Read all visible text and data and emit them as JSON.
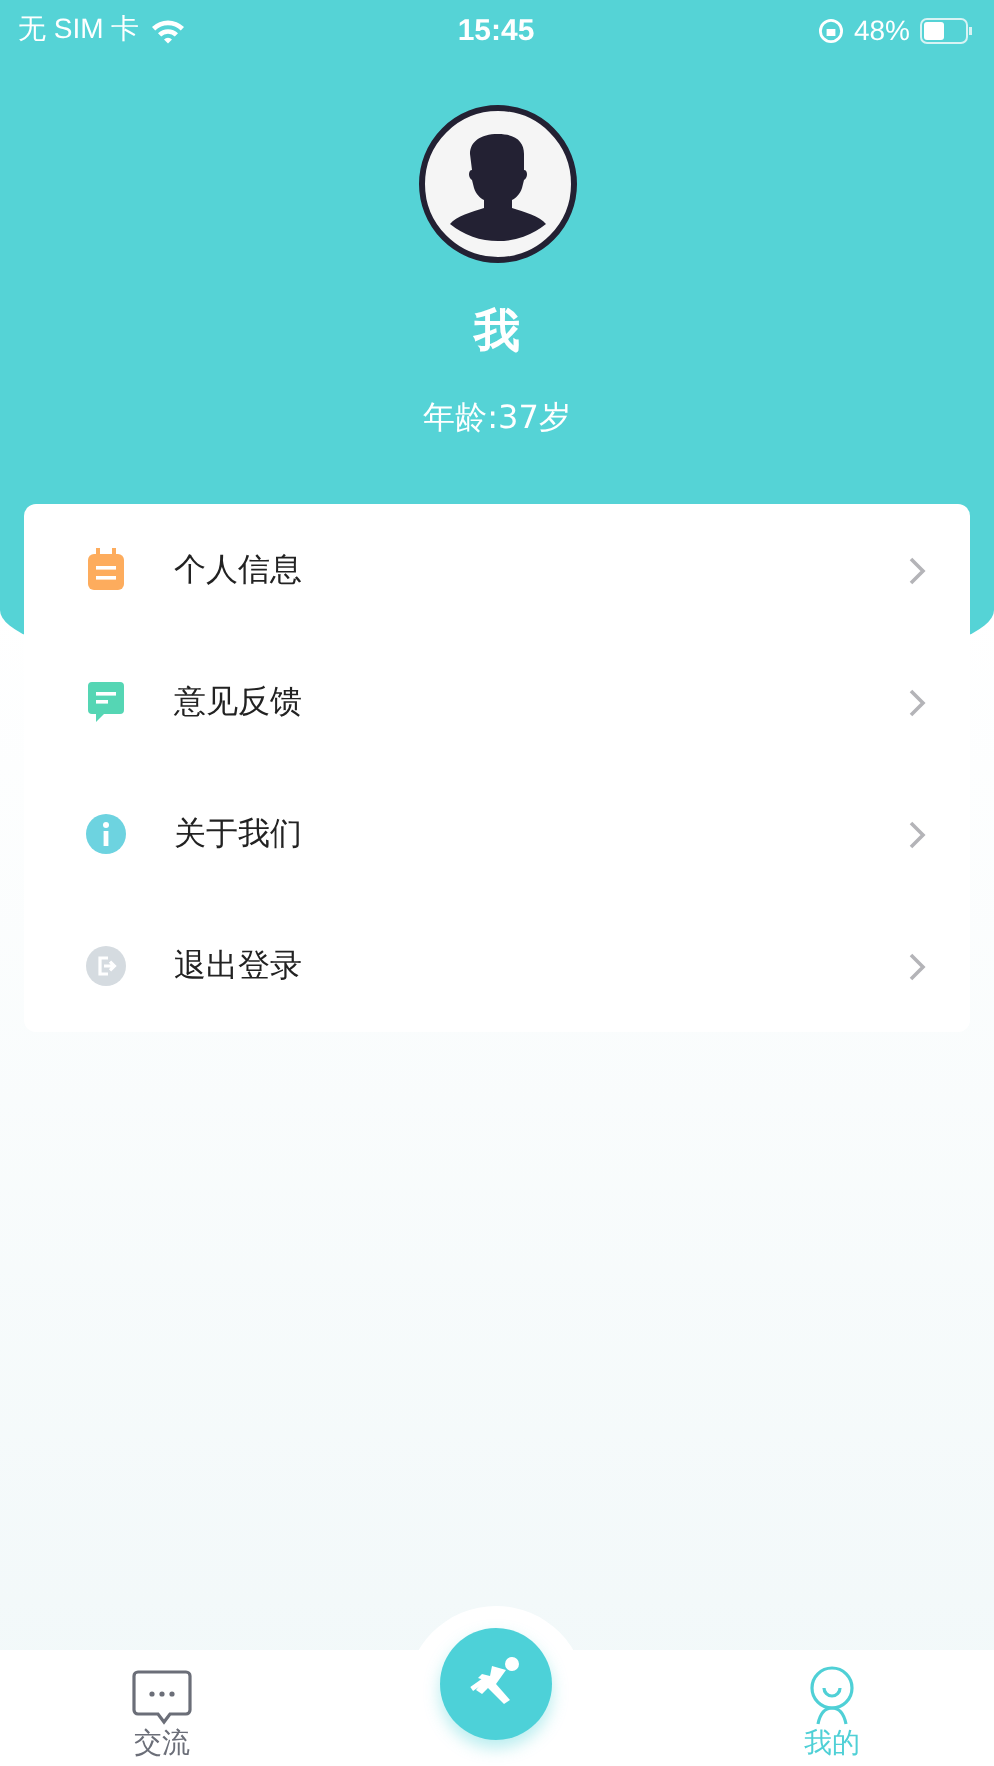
{
  "status_bar": {
    "carrier": "无 SIM 卡",
    "time": "15:45",
    "battery": "48%"
  },
  "profile": {
    "name": "我",
    "age": "年龄:37岁"
  },
  "menu": [
    {
      "kind": "profile",
      "label": "个人信息"
    },
    {
      "kind": "feedback",
      "label": "意见反馈"
    },
    {
      "kind": "about",
      "label": "关于我们"
    },
    {
      "kind": "logout",
      "label": "退出登录"
    }
  ],
  "tab_bar": [
    {
      "kind": "chat",
      "label": "交流",
      "selected": false
    },
    {
      "kind": "action"
    },
    {
      "kind": "me",
      "label": "我的",
      "selected": true
    }
  ]
}
